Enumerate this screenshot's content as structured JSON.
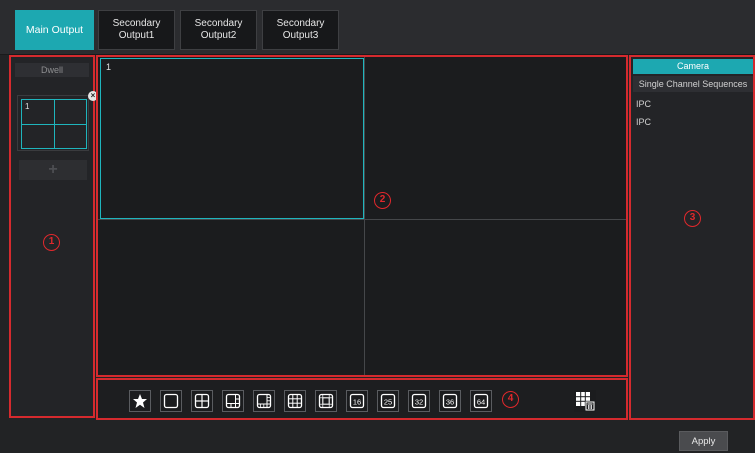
{
  "tabs": [
    {
      "label": "Main Output",
      "active": true
    },
    {
      "label": "Secondary\nOutput1",
      "active": false
    },
    {
      "label": "Secondary\nOutput2",
      "active": false
    },
    {
      "label": "Secondary\nOutput3",
      "active": false
    }
  ],
  "left_panel": {
    "dwell_label": "Dwell",
    "thumbnail_number": "1",
    "close_glyph": "×",
    "add_glyph": "+",
    "marker": "1"
  },
  "video": {
    "selected_cell_number": "1",
    "marker": "2"
  },
  "right_panel": {
    "camera_tab": "Camera",
    "sequence_tab": "Single Channel Sequences",
    "items": [
      "IPC",
      "IPC"
    ],
    "marker": "3"
  },
  "toolbar": {
    "marker": "4",
    "layouts": [
      {
        "icon": "star-icon",
        "label": ""
      },
      {
        "icon": "layout-1-icon",
        "label": ""
      },
      {
        "icon": "layout-4-icon",
        "label": ""
      },
      {
        "icon": "layout-6-icon",
        "label": ""
      },
      {
        "icon": "layout-8-icon",
        "label": ""
      },
      {
        "icon": "layout-9-icon",
        "label": ""
      },
      {
        "icon": "layout-13-icon",
        "label": ""
      },
      {
        "icon": "layout-16-icon",
        "label": "16"
      },
      {
        "icon": "layout-25-icon",
        "label": "25"
      },
      {
        "icon": "layout-32-icon",
        "label": "32"
      },
      {
        "icon": "layout-36-icon",
        "label": "36"
      },
      {
        "icon": "layout-64-icon",
        "label": "64"
      }
    ],
    "clear_icon": "grid-clear-icon"
  },
  "apply_label": "Apply",
  "colors": {
    "accent": "#1da8b1",
    "highlight_outline": "#d52a2e",
    "background": "#222325"
  }
}
